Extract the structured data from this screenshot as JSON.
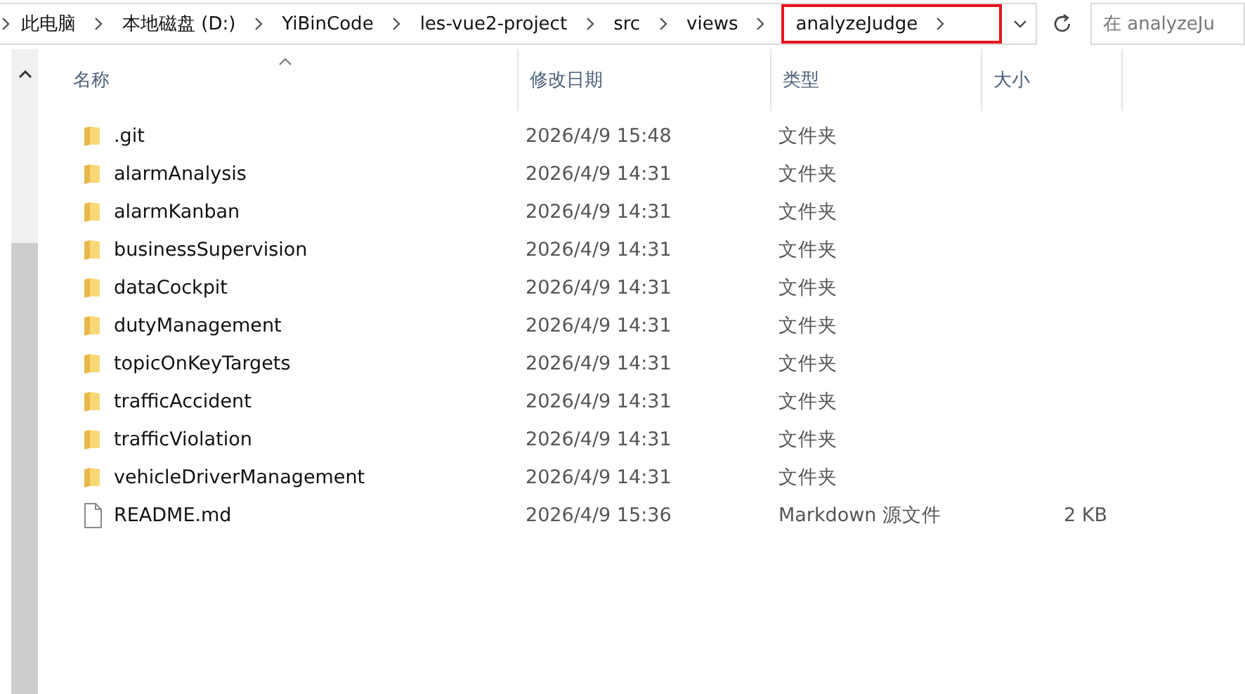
{
  "address_bar": {
    "breadcrumbs": [
      {
        "label": "此电脑",
        "highlighted": false
      },
      {
        "label": "本地磁盘 (D:)",
        "highlighted": false
      },
      {
        "label": "YiBinCode",
        "highlighted": false
      },
      {
        "label": "les-vue2-project",
        "highlighted": false
      },
      {
        "label": "src",
        "highlighted": false
      },
      {
        "label": "views",
        "highlighted": false
      },
      {
        "label": "analyzeJudge",
        "highlighted": true
      }
    ]
  },
  "search": {
    "placeholder": "在 analyzeJu"
  },
  "columns": [
    {
      "label": "名称",
      "sorted": true
    },
    {
      "label": "修改日期",
      "sorted": false
    },
    {
      "label": "类型",
      "sorted": false
    },
    {
      "label": "大小",
      "sorted": false
    }
  ],
  "rows": [
    {
      "kind": "folder",
      "name": ".git",
      "modified": "2026/4/9 15:48",
      "type": "文件夹"
    },
    {
      "kind": "folder",
      "name": "alarmAnalysis",
      "modified": "2026/4/9 14:31",
      "type": "文件夹"
    },
    {
      "kind": "folder",
      "name": "alarmKanban",
      "modified": "2026/4/9 14:31",
      "type": "文件夹"
    },
    {
      "kind": "folder",
      "name": "businessSupervision",
      "modified": "2026/4/9 14:31",
      "type": "文件夹"
    },
    {
      "kind": "folder",
      "name": "dataCockpit",
      "modified": "2026/4/9 14:31",
      "type": "文件夹"
    },
    {
      "kind": "folder",
      "name": "dutyManagement",
      "modified": "2026/4/9 14:31",
      "type": "文件夹"
    },
    {
      "kind": "folder",
      "name": "topicOnKeyTargets",
      "modified": "2026/4/9 14:31",
      "type": "文件夹"
    },
    {
      "kind": "folder",
      "name": "trafficAccident",
      "modified": "2026/4/9 14:31",
      "type": "文件夹"
    },
    {
      "kind": "folder",
      "name": "trafficViolation",
      "modified": "2026/4/9 14:31",
      "type": "文件夹"
    },
    {
      "kind": "folder",
      "name": "vehicleDriverManagement",
      "modified": "2026/4/9 14:31",
      "type": "文件夹"
    },
    {
      "kind": "file",
      "name": "README.md",
      "modified": "2026/4/9 15:36",
      "type": "Markdown 源文件",
      "size": "2 KB"
    }
  ]
}
